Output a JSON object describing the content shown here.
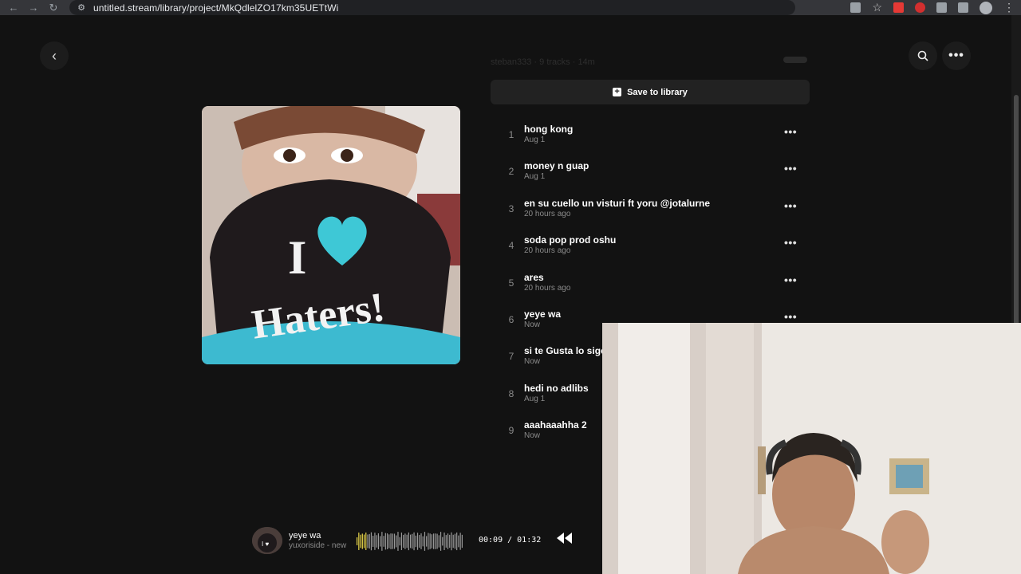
{
  "browser": {
    "url": "untitled.stream/library/project/MkQdlelZO17km35UETtWi"
  },
  "project": {
    "meta": "steban333 · 9 tracks · 14m",
    "save_label": "Save to library",
    "cover_text_line1": "I",
    "cover_text_line2": "Haters!"
  },
  "tracks": [
    {
      "num": "1",
      "title": "hong kong",
      "date": "Aug 1",
      "has_menu": true
    },
    {
      "num": "2",
      "title": "money n guap",
      "date": "Aug 1",
      "has_menu": true
    },
    {
      "num": "3",
      "title": "en su cuello un visturi ft yoru @jotalurne",
      "date": "20 hours ago",
      "has_menu": true
    },
    {
      "num": "4",
      "title": "soda pop prod oshu",
      "date": "20 hours ago",
      "has_menu": true
    },
    {
      "num": "5",
      "title": "ares",
      "date": "20 hours ago",
      "has_menu": true
    },
    {
      "num": "6",
      "title": "yeye wa",
      "date": "Now",
      "has_menu": true
    },
    {
      "num": "7",
      "title": "si te Gusta lo sigo",
      "date": "Now",
      "has_menu": false
    },
    {
      "num": "8",
      "title": "hedi no adlibs",
      "date": "Aug 1",
      "has_menu": false
    },
    {
      "num": "9",
      "title": "aaahaaahha 2",
      "date": "Now",
      "has_menu": false
    }
  ],
  "player": {
    "title": "yeye wa",
    "subtitle": "yuxoriside - new",
    "time": "00:09 / 01:32",
    "progress": 0.098
  },
  "icons": {
    "back": "chevron-left-icon",
    "search": "search-icon",
    "more": "more-horizontal-icon",
    "save": "plus-square-icon",
    "rewind": "rewind-icon"
  },
  "colors": {
    "background": "#121212",
    "accent_wave": "#e8d54a",
    "text_muted": "#8a8a8a"
  }
}
